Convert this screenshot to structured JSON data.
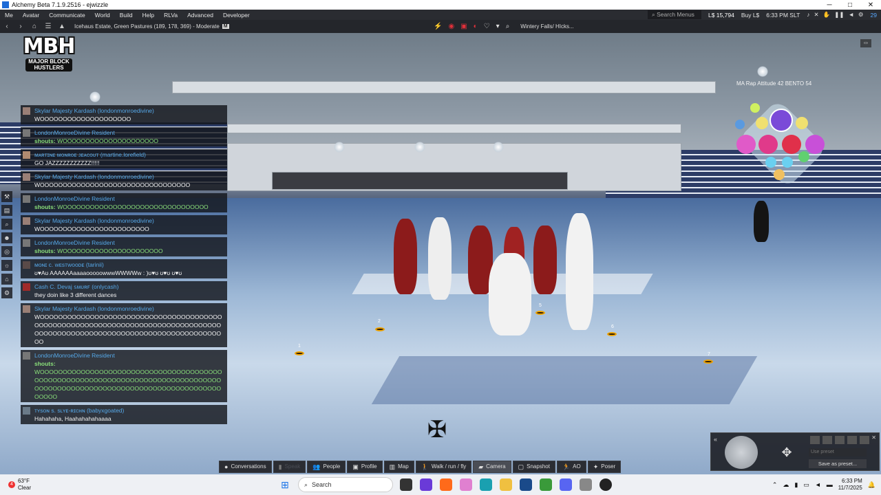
{
  "window": {
    "title": "Alchemy Beta 7.1.9.2516 - ejwizzle",
    "minimize": "─",
    "maximize": "□",
    "close": "✕"
  },
  "menu": {
    "items": [
      "Me",
      "Avatar",
      "Communicate",
      "World",
      "Build",
      "Help",
      "RLVa",
      "Advanced",
      "Developer"
    ],
    "search_placeholder": "Search Menus",
    "balance": "L$ 15,794",
    "buy": "Buy L$",
    "time": "6:33 PM SLT",
    "fps": "29"
  },
  "nav": {
    "location": "Icehaus Estate, Green Pastures (189, 178, 369) - Moderate",
    "maturity": "M",
    "parcel": "Wintery Falls/ HIcks..."
  },
  "logo": {
    "main": "MBH",
    "sub": "MAJOR BLOCK\nHUSTLERS"
  },
  "hud": {
    "animation_label": "MA Rap Attitude 42 BENTO 54"
  },
  "chat": [
    {
      "name": "Skylar Majesty Kardash (londonmonroedivine)",
      "text": "WOOOOOOOOOOOOOOOOOOOO",
      "shout": false
    },
    {
      "name": "LondonMonroeDivine Resident",
      "text": "WOOOOOOOOOOOOOOOOOOOOO",
      "shout": true
    },
    {
      "name": "ᴍᴀʀᴛɪɴᴇ ᴍᴏɴʀᴏᴇ ᴊᴇᴀᴄᴏᴜᴛ (martine.lorefield)",
      "text": "GO JAZZZZZZZZZZZ!!!!!",
      "shout": false
    },
    {
      "name": "Skylar Majesty Kardash (londonmonroedivine)",
      "text": "WOOOOOOOOOOOOOOOOOOOOOOOOOOOOOOOOO",
      "shout": false
    },
    {
      "name": "LondonMonroeDivine Resident",
      "text": "WOOOOOOOOOOOOOOOOOOOOOOOOOOOOOOOO",
      "shout": true
    },
    {
      "name": "Skylar Majesty Kardash (londonmonroedivine)",
      "text": "WOOOOOOOOOOOOOOOOOOOOOOOO",
      "shout": false
    },
    {
      "name": "LondonMonroeDivine Resident",
      "text": "WOOOOOOOOOOOOOOOOOOOOOO",
      "shout": true
    },
    {
      "name": "ᴍᴏɴɪ ᴄ. ᴡᴇsᴛᴡᴏᴏᴅᴇ (tarinii)",
      "text": "ʊ♥Aʊ AAAAAAaaaaooooowwwWWWWw : )ʊ♥ʊ ʊ♥ʊ ʊ♥ʊ",
      "shout": false
    },
    {
      "name": "Cash C. Devaj ꜱᴍᴜʀꜰ (onlycash)",
      "text": "they doin like 3 different dances",
      "shout": false
    },
    {
      "name": "Skylar Majesty Kardash (londonmonroedivine)",
      "text": "WOOOOOOOOOOOOOOOOOOOOOOOOOOOOOOOOOOOOOOOOOOOOOOOOOOOOOOOOOOOOOOOOOOOOOOOOOOOOOOOOOOOOOOOOOOOOOOOOOOOOOOOOOOOOOOOOOOOOOOOOOOOO",
      "shout": false
    },
    {
      "name": "LondonMonroeDivine Resident",
      "text": "WOOOOOOOOOOOOOOOOOOOOOOOOOOOOOOOOOOOOOOOOOOOOOOOOOOOOOOOOOOOOOOOOOOOOOOOOOOOOOOOOOOOOOOOOOOOOOOOOOOOOOOOOOOOOOOOOOOOOOOOOOOOOOOO",
      "shout": true
    },
    {
      "name": "ᴛʏsᴏɴ s. sʟʏᴇ-ʀɪᴄʜɴ (babyxgoated)",
      "text": "Hahahaha, Haahahahahaaaa",
      "shout": false
    }
  ],
  "shout_label": "shouts:",
  "bottom_toolbar": [
    {
      "label": "Conversations",
      "icon": "chat-bubble-icon",
      "state": "normal"
    },
    {
      "label": "Speak",
      "icon": "microphone-icon",
      "state": "disabled"
    },
    {
      "label": "People",
      "icon": "people-icon",
      "state": "normal"
    },
    {
      "label": "Profile",
      "icon": "profile-card-icon",
      "state": "normal"
    },
    {
      "label": "Map",
      "icon": "map-icon",
      "state": "normal"
    },
    {
      "label": "Walk / run / fly",
      "icon": "walk-icon",
      "state": "normal"
    },
    {
      "label": "Camera",
      "icon": "camera-icon",
      "state": "active"
    },
    {
      "label": "Snapshot",
      "icon": "snapshot-icon",
      "state": "normal"
    },
    {
      "label": "AO",
      "icon": "ao-icon",
      "state": "normal"
    },
    {
      "label": "Poser",
      "icon": "poser-icon",
      "state": "normal"
    }
  ],
  "camera_panel": {
    "preset_placeholder": "Use preset",
    "save_preset": "Save as preset..."
  },
  "stage_markers": [
    "1",
    "2",
    "5",
    "6",
    "7"
  ],
  "taskbar": {
    "weather_badge": "4",
    "temperature": "63°F",
    "condition": "Clear",
    "search": "Search",
    "time": "6:33 PM",
    "date": "11/7/2025"
  },
  "colors": {
    "chat_name": "#56a8e8",
    "shout": "#8ae07a",
    "menubar": "#2a2c31"
  }
}
